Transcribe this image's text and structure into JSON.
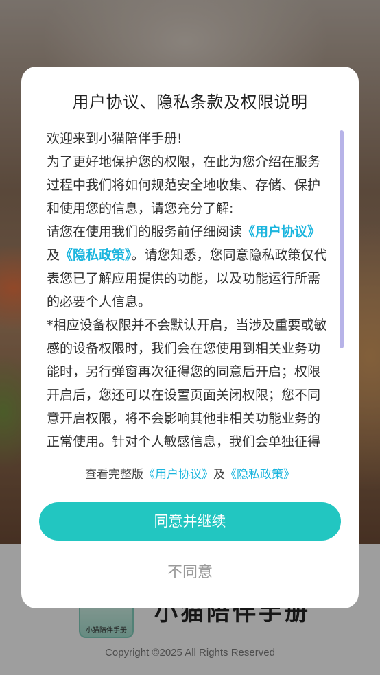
{
  "background": {
    "brand_name": "小猫陪伴手册",
    "logo_text": "小猫陪伴手册",
    "copyright": "Copyright ©2025 All Rights Reserved"
  },
  "dialog": {
    "title": "用户协议、隐私条款及权限说明",
    "content": {
      "p1": "欢迎来到小猫陪伴手册!",
      "p2": "为了更好地保护您的权限，在此为您介绍在服务过程中我们将如何规范安全地收集、存储、保护和使用您的信息，请您充分了解:",
      "p3_prefix": "请您在使用我们的服务前仔细阅读",
      "user_agreement_link": "《用户协议》",
      "p3_and": "及",
      "privacy_policy_link": "《隐私政策》",
      "p3_suffix": "。请您知悉，您同意隐私政策仅代表您已了解应用提供的功能，以及功能运行所需的必要个人信息。",
      "p4": "*相应设备权限并不会默认开启，当涉及重要或敏感的设备权限时，我们会在您使用到相关业务功能时，另行弹窗再次征得您的同意后开启；权限开启后，您还可以在设置页面关闭权限；您不同意开启权限，将不会影响其他非相关功能业务的正常使用。针对个人敏感信息，我们会单独征得您的同意"
    },
    "full_view": {
      "prefix": "查看完整版",
      "user_agreement": "《用户协议》",
      "and": "及",
      "privacy_policy": "《隐私政策》"
    },
    "agree_label": "同意并继续",
    "decline_label": "不同意"
  },
  "colors": {
    "accent": "#22c6c1",
    "link": "#1bb5de",
    "scrollbar": "#b7b3e8"
  }
}
